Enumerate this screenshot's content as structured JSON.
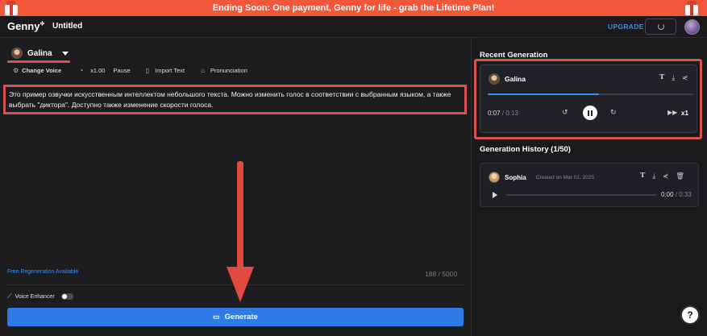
{
  "banner": {
    "text": "Ending Soon: One payment, Genny for life - grab the Lifetime Plan!"
  },
  "header": {
    "logo": "Genny",
    "logo_mark": "✤",
    "doc_title": "Untitled",
    "upgrade_label": "UPGRADE"
  },
  "editor": {
    "voice_name": "Galina",
    "toolbar": {
      "change_voice": "Change Voice",
      "speed": "x1.00",
      "pause": "Pause",
      "import_text": "Import Text",
      "pronunciation": "Pronunciation"
    },
    "text": "Это пример озвучки искусственным интеллектом небольшого текста. Можно изменить голос в соответствии с выбранным языком, а также выбрать \"диктора\". Доступно также изменение скорости голоса.",
    "free_regen": "Free Regeneration Available",
    "char_count": "188 / 5000",
    "voice_enhancer": "Voice Enhancer",
    "generate_label": "Generate"
  },
  "recent": {
    "title": "Recent Generation",
    "voice_name": "Galina",
    "current_time": "0:07",
    "total_time": "0:13",
    "progress": 0.54,
    "speed": "x1"
  },
  "history": {
    "title": "Generation History (1/50)",
    "items": [
      {
        "voice_name": "Sophia",
        "created": "Created on Mar 02, 2025",
        "current_time": "0:00",
        "total_time": "0:33"
      }
    ]
  },
  "colors": {
    "accent": "#3b8bf0",
    "banner": "#f2563b",
    "highlight": "#d9534f",
    "generate": "#2d7be6"
  }
}
